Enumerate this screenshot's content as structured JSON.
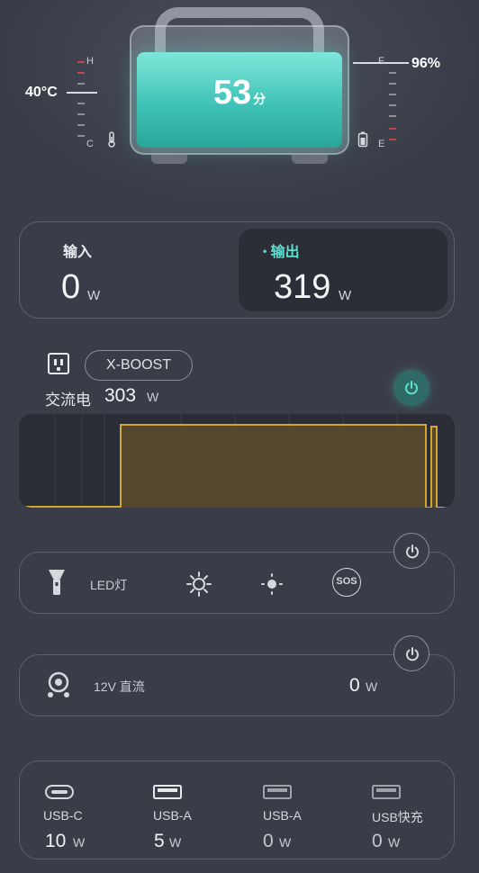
{
  "battery": {
    "temperature": "40°C",
    "temp_high": "H",
    "temp_low": "C",
    "minutes": "53",
    "minutes_unit": "分",
    "charge_percent": "96%",
    "charge_full": "F",
    "charge_empty": "E",
    "level": 0.96
  },
  "power": {
    "input_label": "输入",
    "input_value": "0",
    "input_unit": "W",
    "output_label": "输出",
    "output_dot": "•",
    "output_value": "319",
    "output_unit": "W"
  },
  "ac": {
    "mode_button": "X-BOOST",
    "label": "交流电",
    "value": "303",
    "unit": "W",
    "power_icon": "power-icon",
    "on": true
  },
  "led": {
    "label": "LED灯",
    "modes": [
      "bright-sun-icon",
      "dim-sun-icon",
      "sos-icon"
    ],
    "sos_text": "SOS"
  },
  "dc12v": {
    "label": "12V 直流",
    "value": "0",
    "unit": "W"
  },
  "usb": [
    {
      "label": "USB-C",
      "value": "10",
      "unit": "W",
      "icon": "usb-c-icon"
    },
    {
      "label": "USB-A",
      "value": "5",
      "unit": "W",
      "icon": "usb-a-icon"
    },
    {
      "label": "USB-A",
      "value": "0",
      "unit": "W",
      "icon": "usb-a-icon"
    },
    {
      "label": "USB快充",
      "value": "0",
      "unit": "W",
      "icon": "usb-fast-icon"
    }
  ],
  "colors": {
    "background": "#3a3d48",
    "accent_teal": "#5fe0cf",
    "chart_line": "#d4a531"
  }
}
